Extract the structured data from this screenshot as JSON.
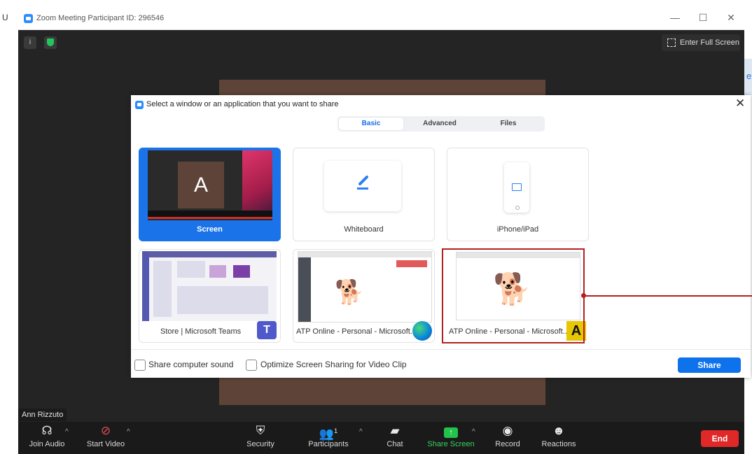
{
  "window": {
    "title": "Zoom Meeting Participant ID: 296546",
    "controls": [
      "—",
      "☐",
      "✕"
    ],
    "left_peek_letter": "U",
    "right_peek_letter": "e"
  },
  "meeting": {
    "info_symbol": "i",
    "fullscreen_label": "Enter Full Screen",
    "participant_name": "Ann Rizzuto"
  },
  "toolbar": {
    "join_audio": "Join Audio",
    "start_video": "Start Video",
    "security": "Security",
    "participants": "Participants",
    "participants_count": "1",
    "chat": "Chat",
    "share_screen": "Share Screen",
    "record": "Record",
    "reactions": "Reactions",
    "end": "End"
  },
  "dialog": {
    "title": "Select a window or an application that you want to share",
    "close": "✕",
    "tabs": [
      "Basic",
      "Advanced",
      "Files"
    ],
    "active_tab": "Basic",
    "options": [
      {
        "label": "Screen",
        "selected": true,
        "thumb_letter": "A"
      },
      {
        "label": "Whiteboard"
      },
      {
        "label": "iPhone/iPad"
      },
      {
        "label": "Store | Microsoft Teams",
        "app_icon": "T"
      },
      {
        "label": "ATP Online - Personal - Microsoft..."
      },
      {
        "label": "ATP Online - Personal - Microsoft...",
        "app_icon": "A"
      }
    ],
    "footer": {
      "share_sound": "Share computer sound",
      "optimize": "Optimize Screen Sharing for Video Clip",
      "share_button": "Share"
    }
  },
  "colors": {
    "accent": "#0e72ed",
    "selected_card": "#1a73e8",
    "end_button": "#e02828",
    "share_screen_green": "#23c24a",
    "highlight_red": "#b32121",
    "meeting_bg": "#242424"
  }
}
